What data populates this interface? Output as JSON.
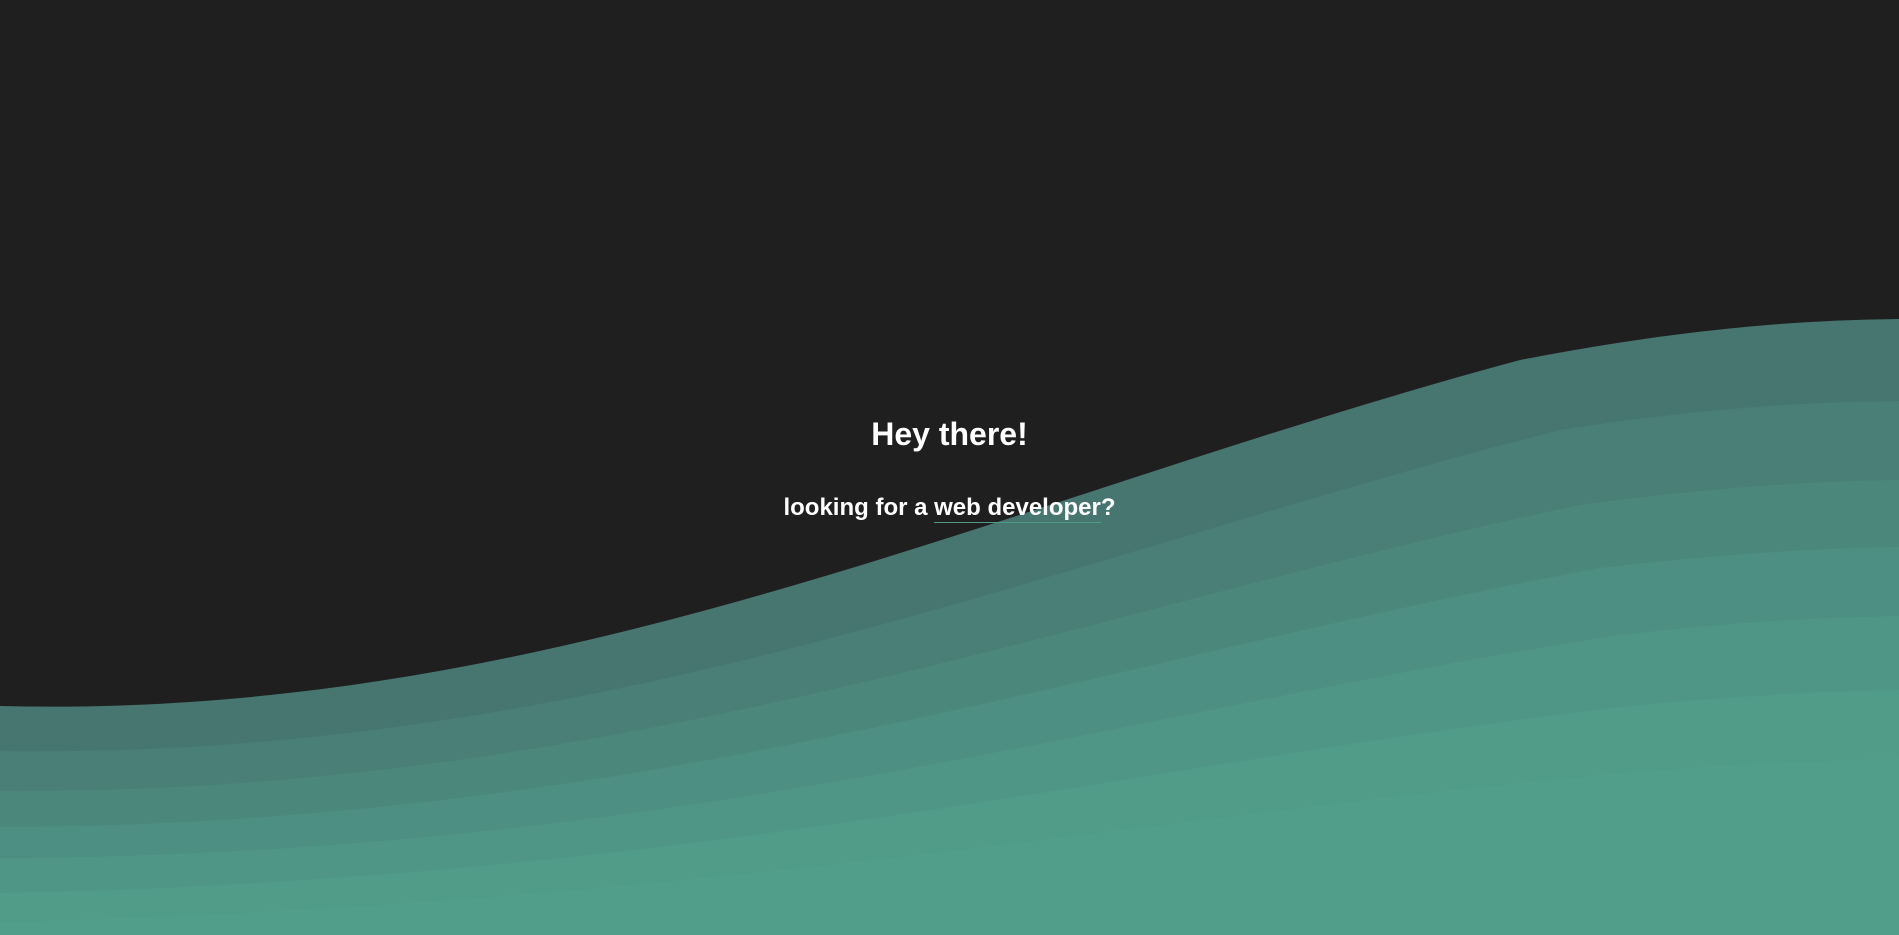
{
  "hero": {
    "title": "Hey there!",
    "subtitle_prefix": "looking for a ",
    "subtitle_link": "web developer",
    "subtitle_suffix": "?"
  },
  "colors": {
    "background": "#1f1f1f",
    "text": "#ffffff",
    "wave_layers": [
      "#477671",
      "#4a7f77",
      "#4c877c",
      "#4d8f82",
      "#4f9686",
      "#509c89",
      "#519f8b"
    ]
  }
}
